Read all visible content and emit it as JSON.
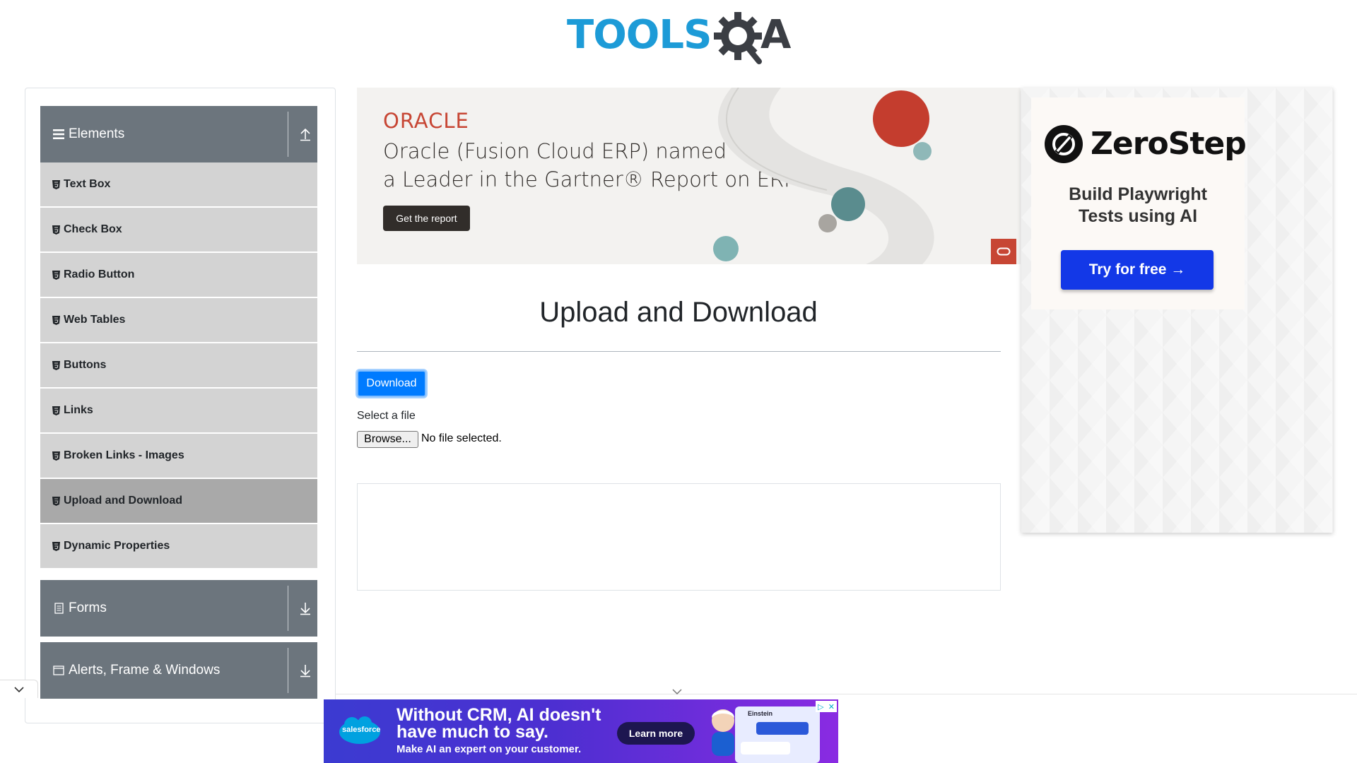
{
  "header": {
    "logo_tools": "TOOLS",
    "logo_a": "A"
  },
  "sidebar": {
    "groups": [
      {
        "title": "Elements",
        "icon": "hamburger-icon",
        "state": "expanded"
      },
      {
        "title": "Forms",
        "icon": "document-icon",
        "state": "collapsed"
      },
      {
        "title": "Alerts, Frame & Windows",
        "icon": "window-icon",
        "state": "collapsed"
      }
    ],
    "items": [
      {
        "label": "Text Box"
      },
      {
        "label": "Check Box"
      },
      {
        "label": "Radio Button"
      },
      {
        "label": "Web Tables"
      },
      {
        "label": "Buttons"
      },
      {
        "label": "Links"
      },
      {
        "label": "Broken Links - Images"
      },
      {
        "label": "Upload and Download",
        "active": true
      },
      {
        "label": "Dynamic Properties"
      }
    ]
  },
  "oracle_ad": {
    "logo": "ORACLE",
    "headline_line1": "Oracle (Fusion Cloud ERP) named",
    "headline_line2": "a Leader in the Gartner® Report on ERP",
    "cta": "Get the report",
    "brand_color": "#c74634"
  },
  "main": {
    "title": "Upload and Download",
    "download_button": "Download",
    "file_label": "Select a file",
    "browse_button": "Browse...",
    "file_status": "No file selected.",
    "accent_color": "#007bff"
  },
  "right_ad": {
    "brand": "ZeroStep",
    "tagline_line1": "Build Playwright",
    "tagline_line2": "Tests using AI",
    "cta": "Try for free →",
    "cta_color": "#1338e7"
  },
  "bottom_ad": {
    "brand": "salesforce",
    "line1": "Without CRM, AI doesn't",
    "line2": "have much to say.",
    "line3": "Make AI an expert on your customer.",
    "cta": "Learn more",
    "mock_title": "Einstein"
  }
}
